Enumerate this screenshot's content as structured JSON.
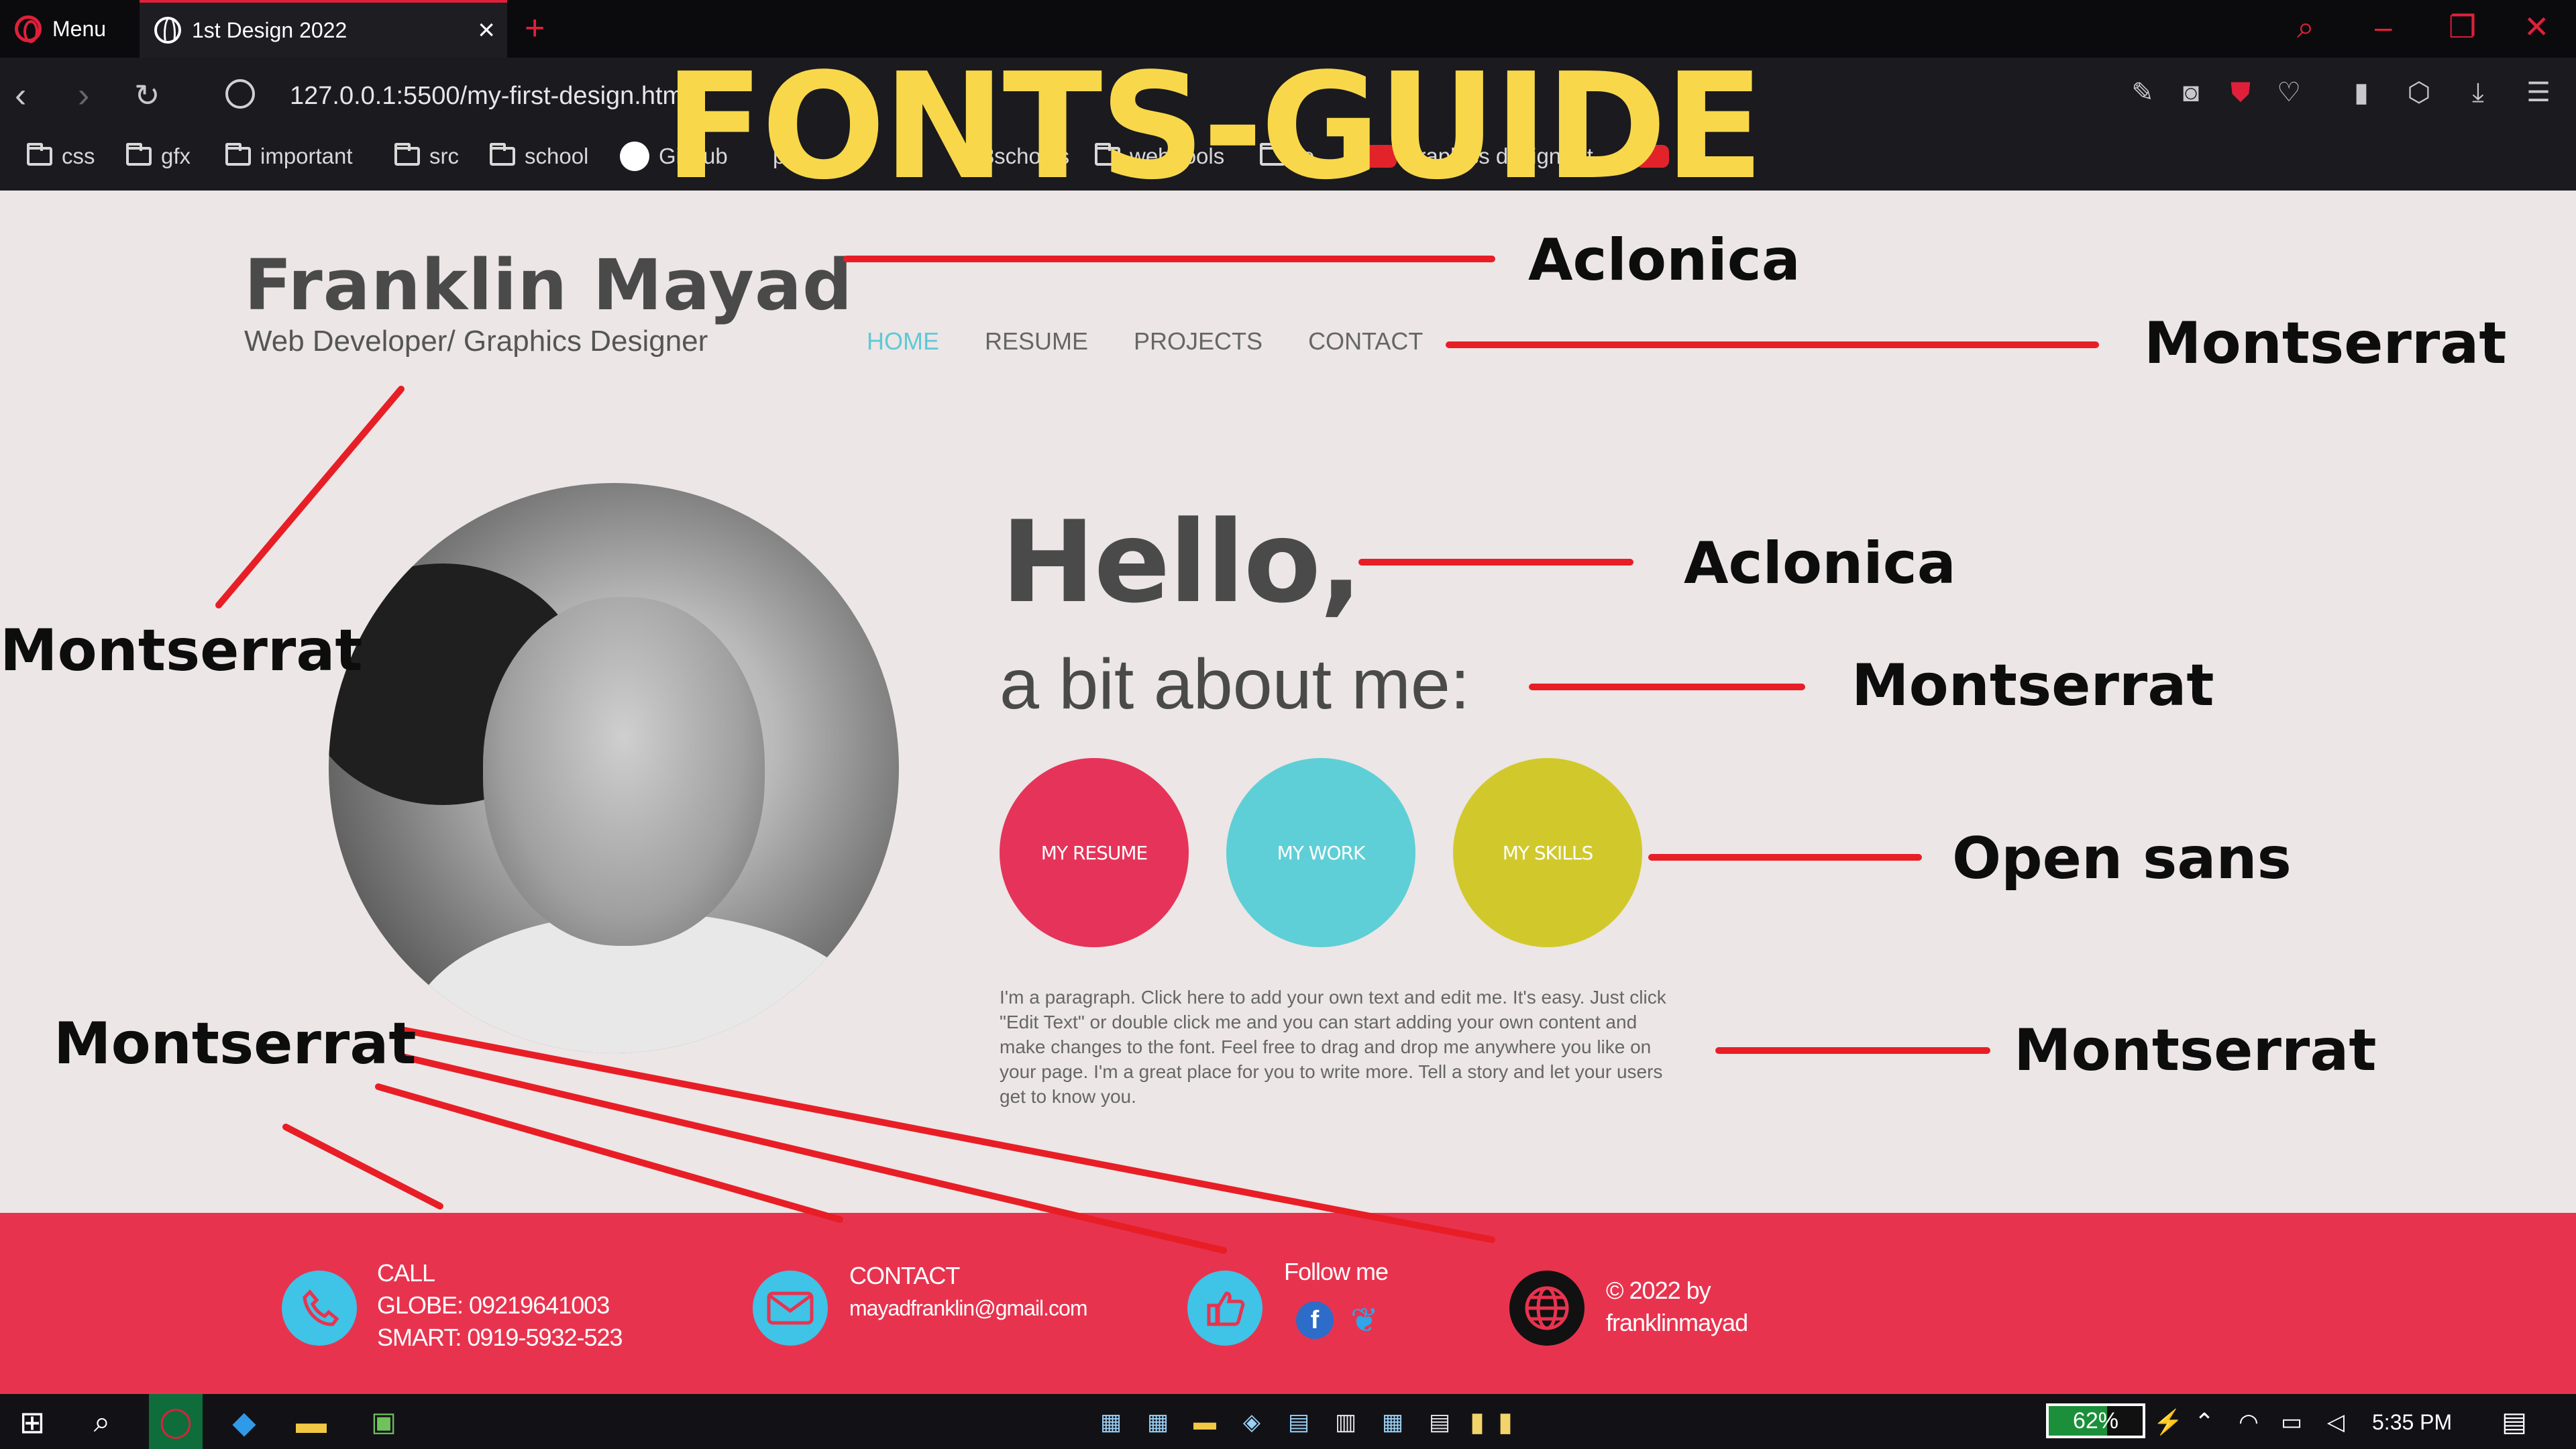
{
  "browser": {
    "menu_label": "Menu",
    "tab_title": "1st Design 2022",
    "url": "127.0.0.1:5500/my-first-design.htm",
    "bookmarks": [
      "css",
      "gfx",
      "important",
      "src",
      "school",
      "GitHub",
      "pk",
      "w3schools",
      "web-tools",
      "re",
      "graphics designer t...",
      "js"
    ]
  },
  "site": {
    "name": "Franklin Mayad",
    "tagline": "Web Developer/ Graphics Designer",
    "nav": [
      "HOME",
      "RESUME",
      "PROJECTS",
      "CONTACT"
    ],
    "hello": "Hello,",
    "about": "a bit about me:",
    "buttons": [
      {
        "label": "MY RESUME",
        "color": "#e6335a"
      },
      {
        "label": "MY WORK",
        "color": "#5ecfd6"
      },
      {
        "label": "MY SKILLS",
        "color": "#d1c92c"
      }
    ],
    "paragraph": "I'm a paragraph. Click here to add your own text and edit me. It's easy. Just click \"Edit Text\" or double click me and you can start adding your own content and make changes to the font. Feel free to drag and drop me anywhere you like on your page. I'm a great place for you to write more. Tell a story and let your users get to know you.",
    "footer": {
      "call_title": "CALL",
      "call_globe": "GLOBE: 09219641003",
      "call_smart": "SMART: 0919-5932-523",
      "contact_title": "CONTACT",
      "contact_email": "mayadfranklin@gmail.com",
      "follow_title": "Follow me",
      "copyright_line1": "© 2022 by",
      "copyright_line2": "franklinmayad"
    }
  },
  "annotations": {
    "title": "FONTS-GUIDE",
    "labels": [
      "Aclonica",
      "Montserrat",
      "Montserrat",
      "Aclonica",
      "Montserrat",
      "Open sans",
      "Montserrat",
      "Montserrat"
    ]
  },
  "taskbar": {
    "battery": "62%",
    "time": "5:35 PM"
  },
  "colors": {
    "accent_red": "#e0203a",
    "footer_bg": "#e8334f",
    "annotation_title": "#f8d84a",
    "annotation_line": "#e81e26"
  }
}
